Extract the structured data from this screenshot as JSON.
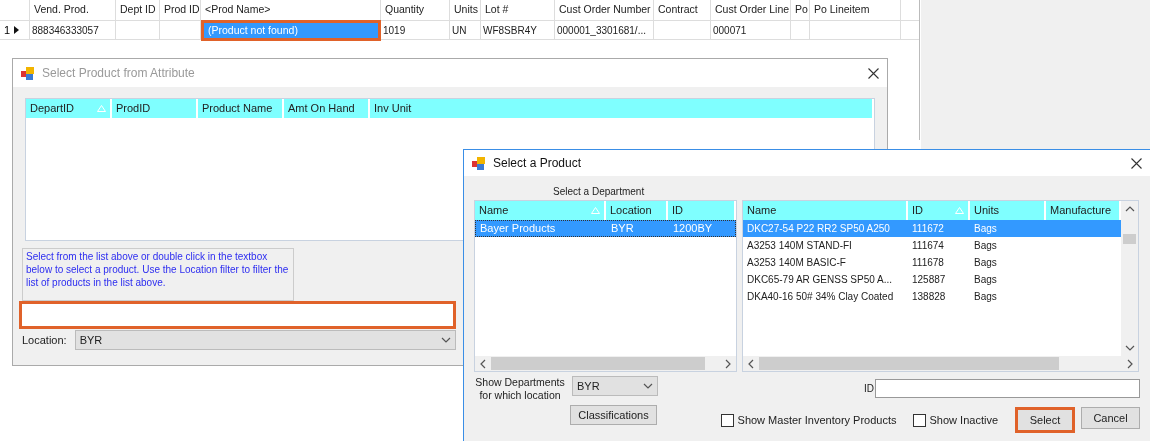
{
  "grid": {
    "columns": [
      {
        "label": "Vend. Prod."
      },
      {
        "label": "Dept ID"
      },
      {
        "label": "Prod ID"
      },
      {
        "label": "<Prod Name>"
      },
      {
        "label": "Quantity"
      },
      {
        "label": "Units"
      },
      {
        "label": "Lot #"
      },
      {
        "label": "Cust Order Number"
      },
      {
        "label": "Contract"
      },
      {
        "label": "Cust Order Line"
      },
      {
        "label": "Po"
      },
      {
        "label": "Po Lineitem"
      }
    ],
    "rows": [
      {
        "number": "1",
        "current": true,
        "cells": [
          {
            "text": "888346333057",
            "highlighted": false
          },
          {
            "text": "",
            "highlighted": false
          },
          {
            "text": "",
            "highlighted": false
          },
          {
            "text": "(Product not found)",
            "highlighted": true
          },
          {
            "text": "1019",
            "highlighted": false
          },
          {
            "text": "UN",
            "highlighted": false
          },
          {
            "text": "WF8SBR4Y",
            "highlighted": false
          },
          {
            "text": "000001_3301681/...",
            "highlighted": false
          },
          {
            "text": "",
            "highlighted": false
          },
          {
            "text": "000071",
            "highlighted": false
          },
          {
            "text": "",
            "highlighted": false
          },
          {
            "text": "",
            "highlighted": false
          }
        ]
      }
    ]
  },
  "attribute_dialog": {
    "title": "Select Product from Attribute",
    "columns": [
      {
        "label": "DepartID",
        "sorted": true
      },
      {
        "label": "ProdID",
        "sorted": false
      },
      {
        "label": "Product Name",
        "sorted": false
      },
      {
        "label": "Amt On Hand",
        "sorted": false
      },
      {
        "label": "Inv Unit",
        "sorted": false
      }
    ],
    "info": "Select from the list above or double click in the textbox below to select a product.  Use the Location filter to filter the list of products in the list above.",
    "textbox": {
      "highlighted": true
    },
    "location": {
      "label": "Location:",
      "value": "BYR"
    }
  },
  "product_dialog": {
    "title": "Select a Product",
    "department_heading": "Select a Department",
    "departments": {
      "columns": [
        {
          "label": "Name",
          "sorted": true
        },
        {
          "label": "Location",
          "sorted": false
        },
        {
          "label": "ID",
          "sorted": false
        }
      ],
      "rows": [
        {
          "cells": [
            "Bayer Products",
            "BYR",
            "1200BY"
          ],
          "selected": true
        }
      ]
    },
    "products": {
      "columns": [
        {
          "label": "Name",
          "sorted": false
        },
        {
          "label": "ID",
          "sorted": true
        },
        {
          "label": "Units",
          "sorted": false
        },
        {
          "label": "Manufacture",
          "sorted": false
        }
      ],
      "rows": [
        {
          "cells": [
            "DKC27-54 P22 RR2 SP50 A250",
            "111672",
            "Bags"
          ],
          "selected": true
        },
        {
          "cells": [
            "A3253 140M STAND-FI",
            "111674",
            "Bags"
          ],
          "selected": false
        },
        {
          "cells": [
            "A3253 140M BASIC-F",
            "111678",
            "Bags"
          ],
          "selected": false
        },
        {
          "cells": [
            "DKC65-79 AR GENSS SP50 A...",
            "125887",
            "Bags"
          ],
          "selected": false
        },
        {
          "cells": [
            "DKA40-16 50# 34% Clay Coated",
            "138828",
            "Bags"
          ],
          "selected": false
        }
      ]
    },
    "location_label": "Show Departments for which location",
    "location_value": "BYR",
    "classifications": "Classifications",
    "id_label": "ID",
    "checkboxes": [
      {
        "label": "Show Master Inventory Products",
        "checked": false
      },
      {
        "label": "Show Inactive",
        "checked": false
      }
    ],
    "buttons": [
      {
        "label": "Select",
        "highlighted": true
      },
      {
        "label": "Cancel",
        "highlighted": false
      }
    ]
  }
}
